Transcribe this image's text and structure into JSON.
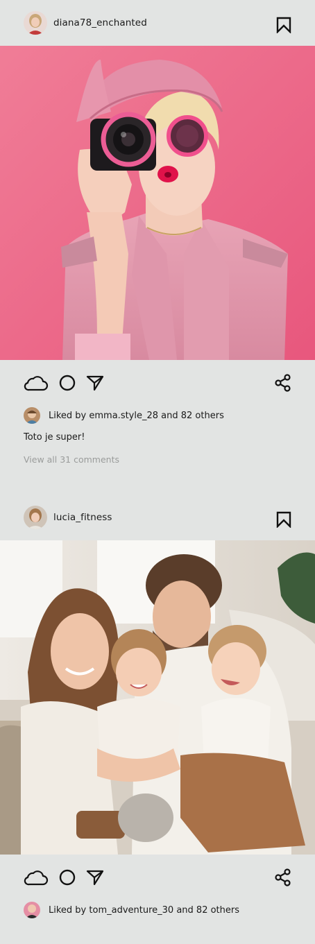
{
  "posts": [
    {
      "username": "diana78_enchanted",
      "liked_by_prefix": "Liked by",
      "liked_by_user": "emma.style_28",
      "liked_by_suffix": "and 82 others",
      "caption": "Toto je super!",
      "view_comments": "View all 31 comments",
      "photo_description": "pink-fashion-photographer"
    },
    {
      "username": "lucia_fitness",
      "liked_by_prefix": "Liked by",
      "liked_by_user": "tom_adventure_30",
      "liked_by_suffix": "and 82 others",
      "photo_description": "family-on-sofa"
    }
  ],
  "icons": {
    "like": "cloud-icon",
    "comment": "circle-icon",
    "send": "paper-plane-icon",
    "share": "share-icon",
    "save": "bookmark-icon"
  },
  "colors": {
    "background": "#e2e4e3",
    "text": "#1a1a1a",
    "muted": "#9a9c9b",
    "pink_bg": "#ec6f8f"
  }
}
